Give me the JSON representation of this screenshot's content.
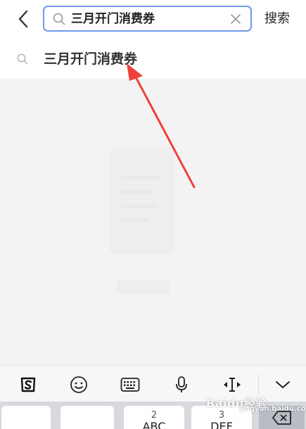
{
  "header": {
    "search_query": "三月开门消费券",
    "search_button_label": "搜索"
  },
  "suggestions": [
    {
      "text": "三月开门消费券"
    }
  ],
  "keyboard": {
    "toolbar_icons": [
      "sogou-logo-icon",
      "emoji-icon",
      "keyboard-icon",
      "microphone-icon",
      "cursor-move-icon",
      "collapse-keyboard-icon"
    ],
    "keys": [
      {
        "num": "",
        "main": "，"
      },
      {
        "num": "",
        "main": ""
      },
      {
        "num": "2",
        "main": "ABC"
      },
      {
        "num": "3",
        "main": "DEF"
      },
      {
        "num": "",
        "main": ""
      }
    ]
  },
  "watermark": {
    "brand": "Baidu经验",
    "sub": "jingyan.baidu.com"
  },
  "colors": {
    "search_border": "#6e9be6",
    "annotation_arrow": "#f0403c"
  }
}
